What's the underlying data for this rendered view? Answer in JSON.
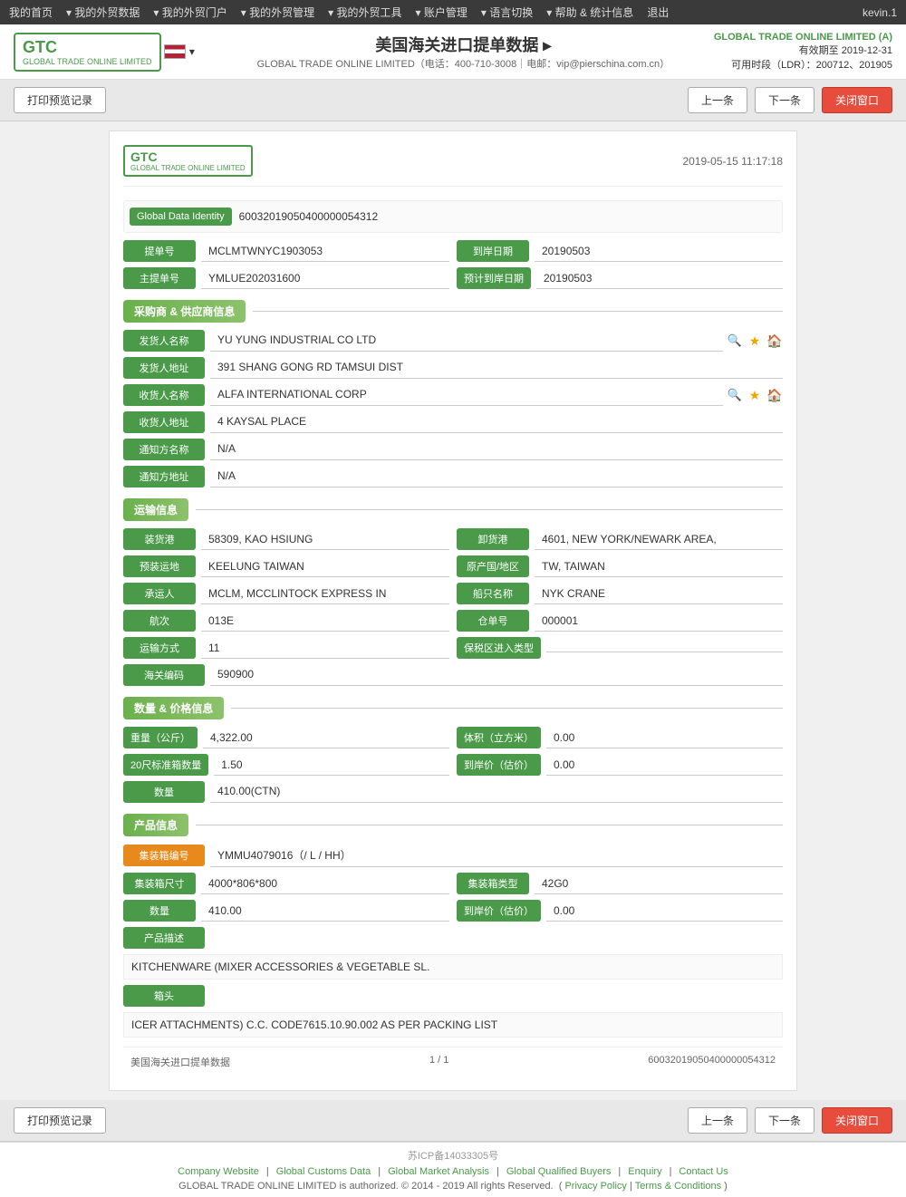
{
  "topNav": {
    "items": [
      "我的首页",
      "我的外贸数据",
      "我的外贸门户",
      "我的外贸管理",
      "我的外贸工具",
      "账户管理",
      "语言切换",
      "帮助 & 统计信息",
      "退出"
    ],
    "user": "kevin.1"
  },
  "header": {
    "logoText": "GTC",
    "logoSub": "GLOBAL TRADE ONLINE LIMITED",
    "title": "美国海关进口提单数据",
    "subtitle": "GLOBAL TRADE ONLINE LIMITED（电话：400-710-3008｜电邮：vip@pierschina.com.cn）",
    "company": "GLOBAL TRADE ONLINE LIMITED (A)",
    "validUntil": "有效期至 2019-12-31",
    "ldr": "可用时段（LDR）：200712、201905"
  },
  "actionBar": {
    "printBtn": "打印预览记录",
    "prevBtn": "上一条",
    "nextBtn": "下一条",
    "closeBtn": "关闭窗口"
  },
  "document": {
    "logoText": "GTC",
    "logoSub": "GLOBAL TRADE ONLINE LIMITED",
    "datetime": "2019-05-15 11:17:18",
    "globalDataIdentityLabel": "Global Data Identity",
    "globalDataIdentityValue": "60032019050400000054312",
    "billNoLabel": "提单号",
    "billNoValue": "MCLMTWNYC1903053",
    "arrivalDateLabel": "到岸日期",
    "arrivalDateValue": "20190503",
    "masterBillLabel": "主提单号",
    "masterBillValue": "YMLUE202031600",
    "estimatedArrivalLabel": "预计到岸日期",
    "estimatedArrivalValue": "20190503",
    "sections": {
      "supplier": {
        "title": "采购商 & 供应商信息",
        "fields": [
          {
            "label": "发货人名称",
            "value": "YU YUNG INDUSTRIAL CO LTD",
            "hasIcons": true
          },
          {
            "label": "发货人地址",
            "value": "391 SHANG GONG RD TAMSUI DIST",
            "hasIcons": false
          },
          {
            "label": "收货人名称",
            "value": "ALFA INTERNATIONAL CORP",
            "hasIcons": true
          },
          {
            "label": "收货人地址",
            "value": "4 KAYSAL PLACE",
            "hasIcons": false
          },
          {
            "label": "通知方名称",
            "value": "N/A",
            "hasIcons": false
          },
          {
            "label": "通知方地址",
            "value": "N/A",
            "hasIcons": false
          }
        ]
      },
      "transport": {
        "title": "运输信息",
        "fields": [
          {
            "label": "装货港",
            "value": "58309, KAO HSIUNG",
            "pairLabel": "卸货港",
            "pairValue": "4601, NEW YORK/NEWARK AREA,"
          },
          {
            "label": "预装运地",
            "value": "KEELUNG TAIWAN",
            "pairLabel": "原产国/地区",
            "pairValue": "TW, TAIWAN"
          },
          {
            "label": "承运人",
            "value": "MCLM, MCCLINTOCK EXPRESS IN",
            "pairLabel": "船只名称",
            "pairValue": "NYK CRANE"
          },
          {
            "label": "航次",
            "value": "013E",
            "pairLabel": "仓单号",
            "pairValue": "000001"
          },
          {
            "label": "运输方式",
            "value": "11",
            "pairLabel": "保税区进入类型",
            "pairValue": ""
          },
          {
            "label": "海关编码",
            "value": "590900",
            "pairLabel": "",
            "pairValue": ""
          }
        ]
      },
      "quantity": {
        "title": "数量 & 价格信息",
        "fields": [
          {
            "label": "重量（公斤）",
            "value": "4,322.00",
            "pairLabel": "体积（立方米）",
            "pairValue": "0.00"
          },
          {
            "label": "20尺标准箱数量",
            "value": "1.50",
            "pairLabel": "到岸价（估价）",
            "pairValue": "0.00"
          },
          {
            "label": "数量",
            "value": "410.00(CTN)",
            "pairLabel": "",
            "pairValue": ""
          }
        ]
      },
      "product": {
        "title": "产品信息",
        "containerNoLabel": "集装箱编号",
        "containerNoValue": "YMMU4079016（/ L / HH）",
        "containerSizeLabel": "集装箱尺寸",
        "containerSizeValue": "4000*806*800",
        "containerTypeLabel": "集装箱类型",
        "containerTypeValue": "42G0",
        "quantityLabel": "数量",
        "quantityValue": "410.00",
        "priceLabel": "到岸价（估价）",
        "priceValue": "0.00",
        "descriptionLabel": "产品描述",
        "descriptionValue": "KITCHENWARE (MIXER ACCESSORIES & VEGETABLE SL.",
        "headLabel": "箱头",
        "headValue": "ICER ATTACHMENTS) C.C. CODE7615.10.90.002 AS PER PACKING LIST"
      }
    },
    "footer": {
      "title": "美国海关进口提单数据",
      "pageInfo": "1 / 1",
      "docId": "60032019050400000054312"
    }
  },
  "pageFooter": {
    "icp": "苏ICP备14033305号",
    "links": [
      "Company Website",
      "Global Customs Data",
      "Global Market Analysis",
      "Global Qualified Buyers",
      "Enquiry",
      "Contact Us"
    ],
    "copyright": "GLOBAL TRADE ONLINE LIMITED is authorized. © 2014 - 2019 All rights Reserved.",
    "policyLinks": [
      "Privacy Policy",
      "Terms & Conditions"
    ]
  }
}
